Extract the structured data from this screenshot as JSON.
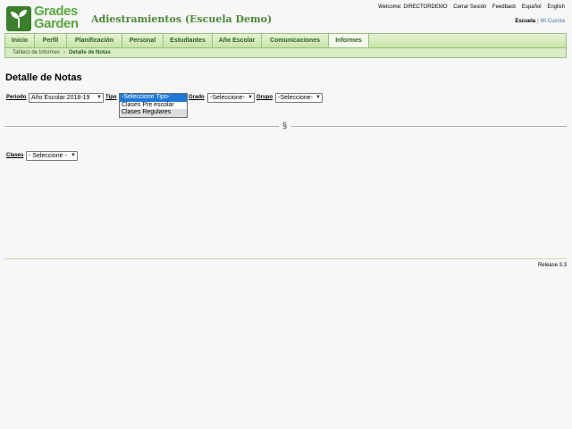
{
  "header": {
    "logo_text_line1": "Grades",
    "logo_text_line2": "Garden",
    "app_title": "Adiestramientos (Escuela Demo)",
    "welcome": "Welcome: DIRECTORDEMO",
    "logout": "Cerrar Sesión",
    "feedback": "Feedback",
    "lang_es": "Español",
    "lang_en": "English",
    "school": "Escuela",
    "account": "Mi Cuenta"
  },
  "nav": {
    "tabs": [
      "Inicio",
      "Perfil",
      "Planificación",
      "Personal",
      "Estudiantes",
      "Año Escolar",
      "Comunicaciones",
      "Informes"
    ],
    "active_tab": "Informes"
  },
  "breadcrumb": {
    "parent": "Tablero de Informes",
    "current": "Detalle de Notas"
  },
  "main": {
    "title": "Detalle de Notas",
    "filters": {
      "periodo_label": "Periodo",
      "periodo_value": "Año Escolar 2018-19",
      "tipo_label": "Tipo",
      "grado_label": "Grado",
      "grado_value": "-Seleccione-",
      "grupo_label": "Grupo",
      "grupo_value": "-Seleccione-"
    },
    "tipo_options": [
      "-Seleccione Tipo-",
      "Clases Pre escolar",
      "Clases Regulares"
    ],
    "section_symbol": "§",
    "clases_label": "Clases",
    "clases_value": "- Seleccione -"
  },
  "footer": {
    "release": "Release 3.3"
  },
  "colors": {
    "brand_green": "#4a8a36",
    "nav_green": "#c8e4aa",
    "highlight_blue": "#1e78d6"
  }
}
